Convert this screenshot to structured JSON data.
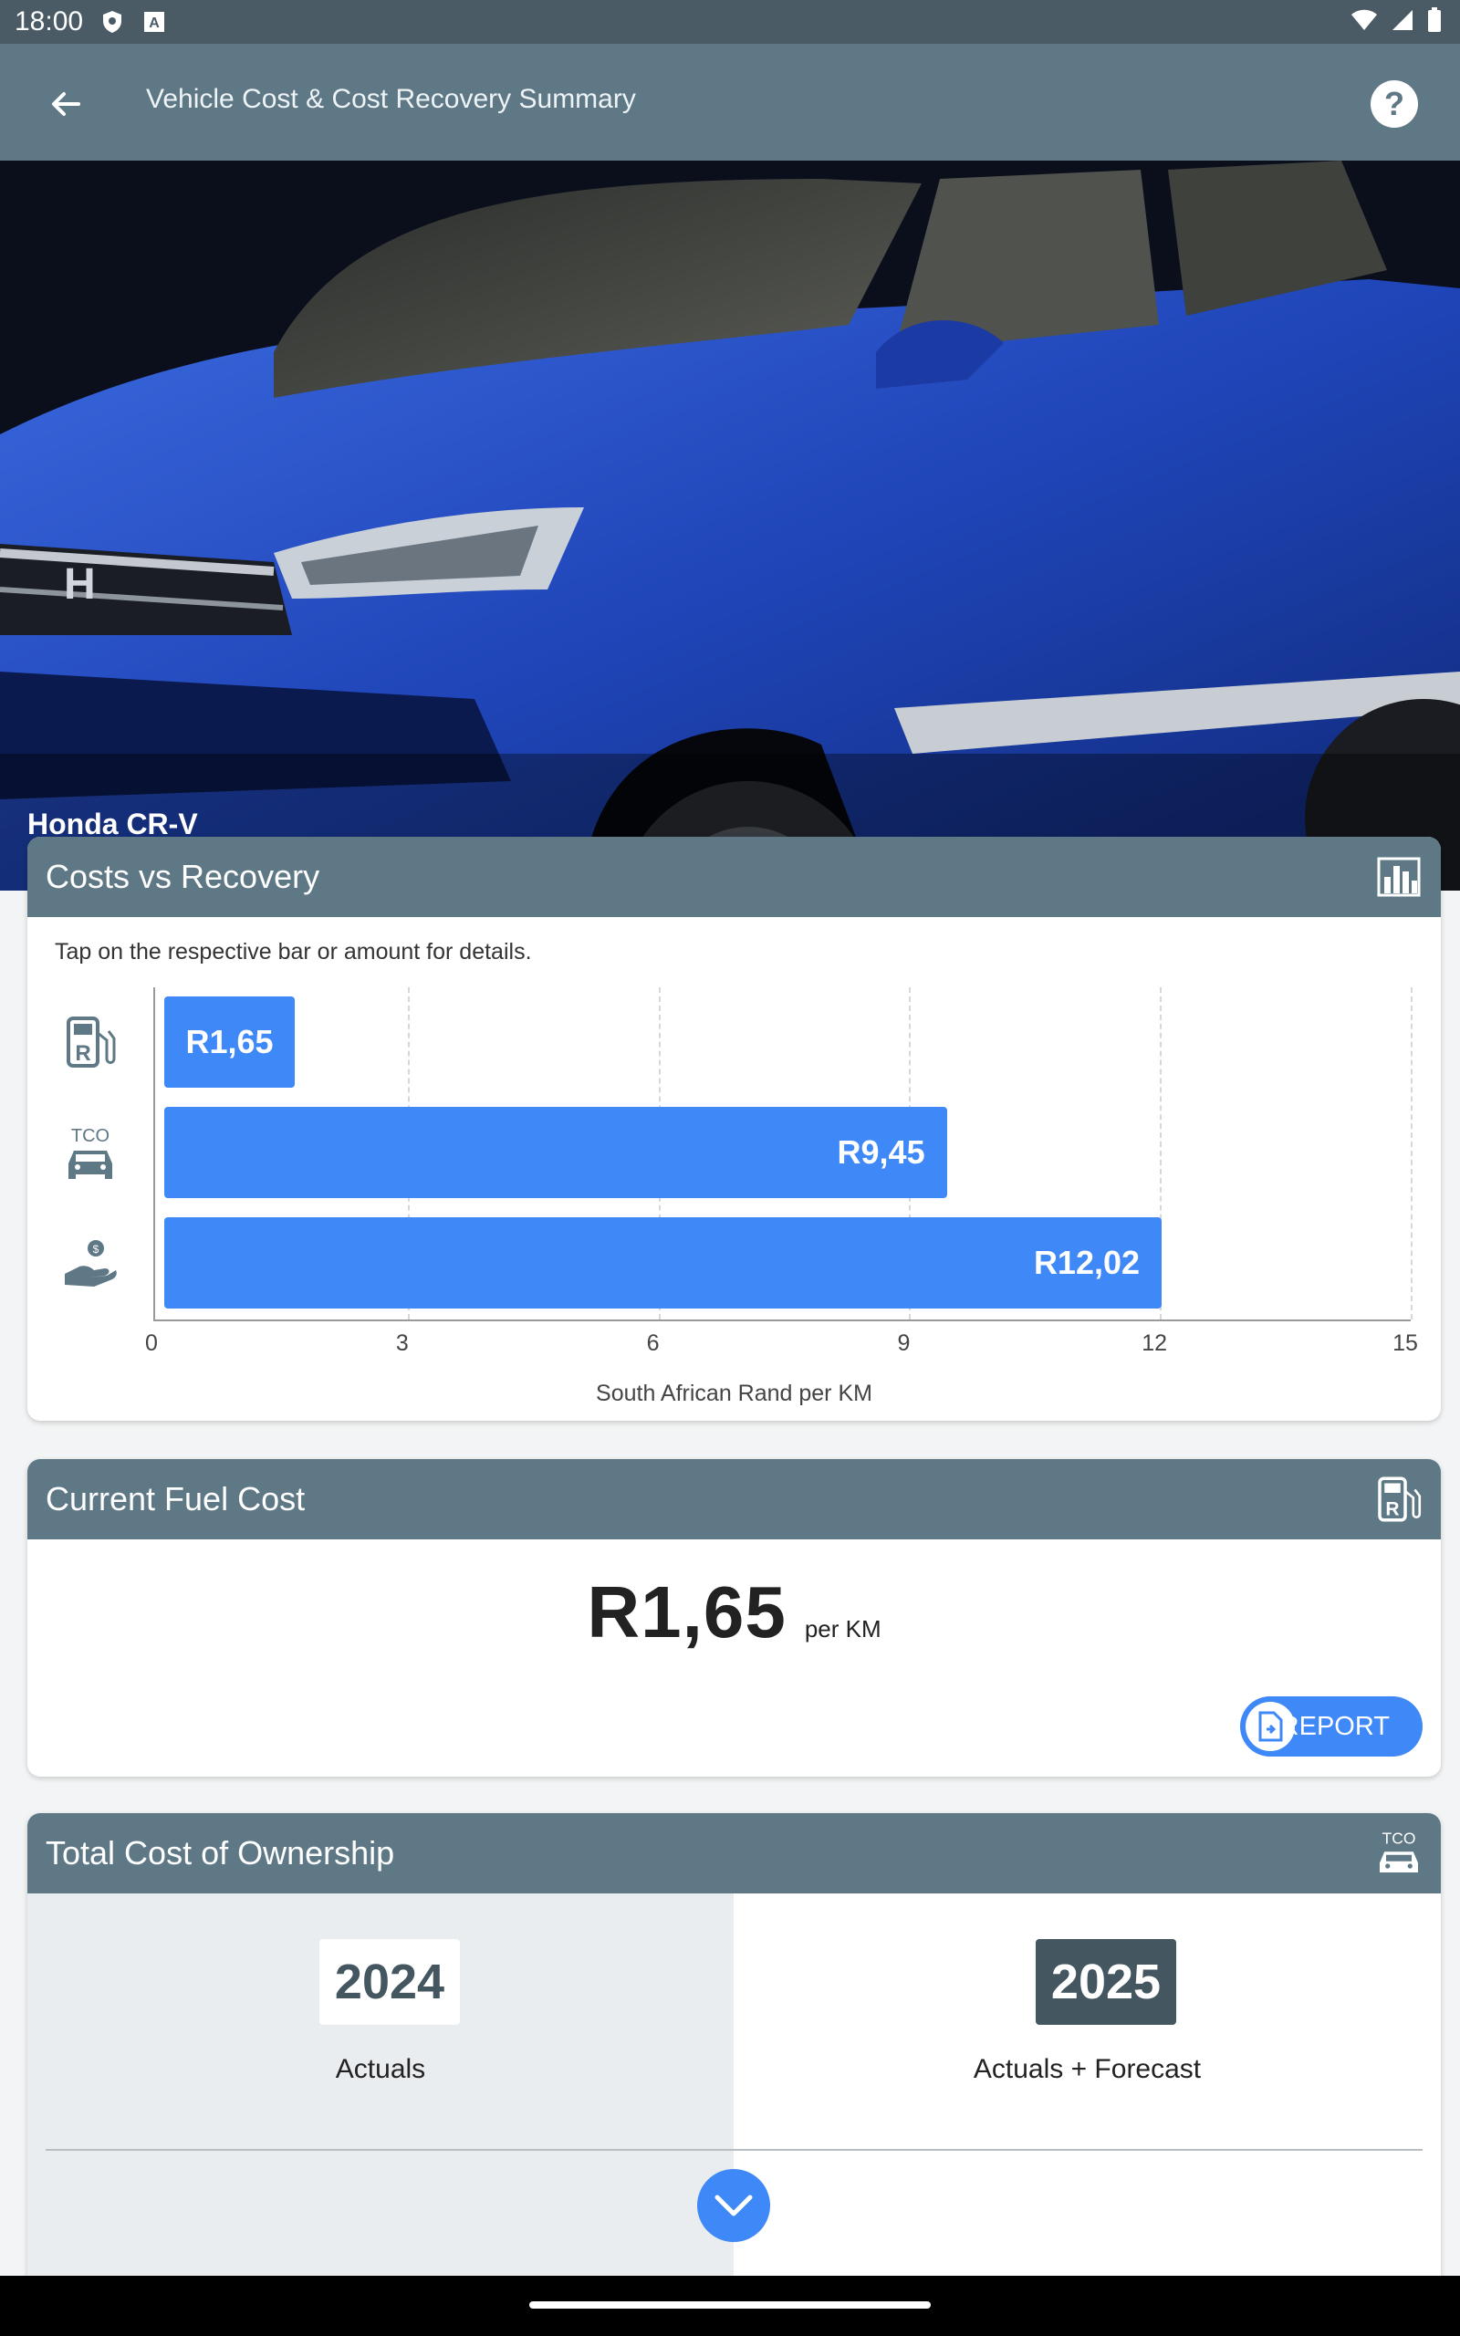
{
  "status": {
    "time": "18:00"
  },
  "appbar": {
    "title": "Vehicle Cost & Cost Recovery Summary"
  },
  "hero": {
    "caption": "Honda CR-V"
  },
  "costs_card": {
    "title": "Costs vs Recovery",
    "hint": "Tap on the respective bar or amount for details."
  },
  "chart_data": {
    "type": "bar",
    "orientation": "horizontal",
    "categories": [
      "fuel",
      "tco",
      "recovery"
    ],
    "values": [
      1.65,
      9.45,
      12.02
    ],
    "value_labels": [
      "R1,65",
      "R9,45",
      "R12,02"
    ],
    "xlim": [
      0,
      15
    ],
    "xticks": [
      "0",
      "3",
      "6",
      "9",
      "12",
      "15"
    ],
    "xlabel": "South African Rand per KM",
    "bar_color": "#3f88f7",
    "grid": true
  },
  "fuel_card": {
    "title": "Current Fuel Cost",
    "amount": "R1,65",
    "unit": "per KM",
    "report_label": "REPORT"
  },
  "tco_card": {
    "title": "Total Cost of Ownership",
    "year_1": "2024",
    "year_1_label": "Actuals",
    "year_2": "2025",
    "year_2_label": "Actuals + Forecast"
  },
  "colors": {
    "header": "#5f7886",
    "accent": "#3f88f7",
    "dark_slate": "#44565f"
  }
}
